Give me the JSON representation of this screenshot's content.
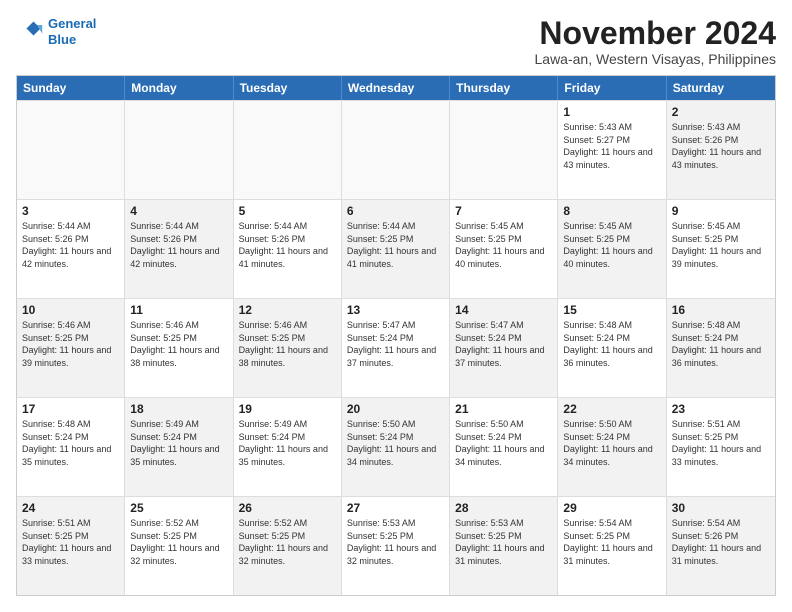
{
  "logo": {
    "line1": "General",
    "line2": "Blue"
  },
  "title": "November 2024",
  "subtitle": "Lawa-an, Western Visayas, Philippines",
  "weekdays": [
    "Sunday",
    "Monday",
    "Tuesday",
    "Wednesday",
    "Thursday",
    "Friday",
    "Saturday"
  ],
  "rows": [
    [
      {
        "day": "",
        "info": "",
        "shaded": false,
        "empty": true
      },
      {
        "day": "",
        "info": "",
        "shaded": false,
        "empty": true
      },
      {
        "day": "",
        "info": "",
        "shaded": false,
        "empty": true
      },
      {
        "day": "",
        "info": "",
        "shaded": false,
        "empty": true
      },
      {
        "day": "",
        "info": "",
        "shaded": false,
        "empty": true
      },
      {
        "day": "1",
        "info": "Sunrise: 5:43 AM\nSunset: 5:27 PM\nDaylight: 11 hours and 43 minutes.",
        "shaded": false,
        "empty": false
      },
      {
        "day": "2",
        "info": "Sunrise: 5:43 AM\nSunset: 5:26 PM\nDaylight: 11 hours and 43 minutes.",
        "shaded": true,
        "empty": false
      }
    ],
    [
      {
        "day": "3",
        "info": "Sunrise: 5:44 AM\nSunset: 5:26 PM\nDaylight: 11 hours and 42 minutes.",
        "shaded": false,
        "empty": false
      },
      {
        "day": "4",
        "info": "Sunrise: 5:44 AM\nSunset: 5:26 PM\nDaylight: 11 hours and 42 minutes.",
        "shaded": true,
        "empty": false
      },
      {
        "day": "5",
        "info": "Sunrise: 5:44 AM\nSunset: 5:26 PM\nDaylight: 11 hours and 41 minutes.",
        "shaded": false,
        "empty": false
      },
      {
        "day": "6",
        "info": "Sunrise: 5:44 AM\nSunset: 5:25 PM\nDaylight: 11 hours and 41 minutes.",
        "shaded": true,
        "empty": false
      },
      {
        "day": "7",
        "info": "Sunrise: 5:45 AM\nSunset: 5:25 PM\nDaylight: 11 hours and 40 minutes.",
        "shaded": false,
        "empty": false
      },
      {
        "day": "8",
        "info": "Sunrise: 5:45 AM\nSunset: 5:25 PM\nDaylight: 11 hours and 40 minutes.",
        "shaded": true,
        "empty": false
      },
      {
        "day": "9",
        "info": "Sunrise: 5:45 AM\nSunset: 5:25 PM\nDaylight: 11 hours and 39 minutes.",
        "shaded": false,
        "empty": false
      }
    ],
    [
      {
        "day": "10",
        "info": "Sunrise: 5:46 AM\nSunset: 5:25 PM\nDaylight: 11 hours and 39 minutes.",
        "shaded": true,
        "empty": false
      },
      {
        "day": "11",
        "info": "Sunrise: 5:46 AM\nSunset: 5:25 PM\nDaylight: 11 hours and 38 minutes.",
        "shaded": false,
        "empty": false
      },
      {
        "day": "12",
        "info": "Sunrise: 5:46 AM\nSunset: 5:25 PM\nDaylight: 11 hours and 38 minutes.",
        "shaded": true,
        "empty": false
      },
      {
        "day": "13",
        "info": "Sunrise: 5:47 AM\nSunset: 5:24 PM\nDaylight: 11 hours and 37 minutes.",
        "shaded": false,
        "empty": false
      },
      {
        "day": "14",
        "info": "Sunrise: 5:47 AM\nSunset: 5:24 PM\nDaylight: 11 hours and 37 minutes.",
        "shaded": true,
        "empty": false
      },
      {
        "day": "15",
        "info": "Sunrise: 5:48 AM\nSunset: 5:24 PM\nDaylight: 11 hours and 36 minutes.",
        "shaded": false,
        "empty": false
      },
      {
        "day": "16",
        "info": "Sunrise: 5:48 AM\nSunset: 5:24 PM\nDaylight: 11 hours and 36 minutes.",
        "shaded": true,
        "empty": false
      }
    ],
    [
      {
        "day": "17",
        "info": "Sunrise: 5:48 AM\nSunset: 5:24 PM\nDaylight: 11 hours and 35 minutes.",
        "shaded": false,
        "empty": false
      },
      {
        "day": "18",
        "info": "Sunrise: 5:49 AM\nSunset: 5:24 PM\nDaylight: 11 hours and 35 minutes.",
        "shaded": true,
        "empty": false
      },
      {
        "day": "19",
        "info": "Sunrise: 5:49 AM\nSunset: 5:24 PM\nDaylight: 11 hours and 35 minutes.",
        "shaded": false,
        "empty": false
      },
      {
        "day": "20",
        "info": "Sunrise: 5:50 AM\nSunset: 5:24 PM\nDaylight: 11 hours and 34 minutes.",
        "shaded": true,
        "empty": false
      },
      {
        "day": "21",
        "info": "Sunrise: 5:50 AM\nSunset: 5:24 PM\nDaylight: 11 hours and 34 minutes.",
        "shaded": false,
        "empty": false
      },
      {
        "day": "22",
        "info": "Sunrise: 5:50 AM\nSunset: 5:24 PM\nDaylight: 11 hours and 34 minutes.",
        "shaded": true,
        "empty": false
      },
      {
        "day": "23",
        "info": "Sunrise: 5:51 AM\nSunset: 5:25 PM\nDaylight: 11 hours and 33 minutes.",
        "shaded": false,
        "empty": false
      }
    ],
    [
      {
        "day": "24",
        "info": "Sunrise: 5:51 AM\nSunset: 5:25 PM\nDaylight: 11 hours and 33 minutes.",
        "shaded": true,
        "empty": false
      },
      {
        "day": "25",
        "info": "Sunrise: 5:52 AM\nSunset: 5:25 PM\nDaylight: 11 hours and 32 minutes.",
        "shaded": false,
        "empty": false
      },
      {
        "day": "26",
        "info": "Sunrise: 5:52 AM\nSunset: 5:25 PM\nDaylight: 11 hours and 32 minutes.",
        "shaded": true,
        "empty": false
      },
      {
        "day": "27",
        "info": "Sunrise: 5:53 AM\nSunset: 5:25 PM\nDaylight: 11 hours and 32 minutes.",
        "shaded": false,
        "empty": false
      },
      {
        "day": "28",
        "info": "Sunrise: 5:53 AM\nSunset: 5:25 PM\nDaylight: 11 hours and 31 minutes.",
        "shaded": true,
        "empty": false
      },
      {
        "day": "29",
        "info": "Sunrise: 5:54 AM\nSunset: 5:25 PM\nDaylight: 11 hours and 31 minutes.",
        "shaded": false,
        "empty": false
      },
      {
        "day": "30",
        "info": "Sunrise: 5:54 AM\nSunset: 5:26 PM\nDaylight: 11 hours and 31 minutes.",
        "shaded": true,
        "empty": false
      }
    ]
  ]
}
